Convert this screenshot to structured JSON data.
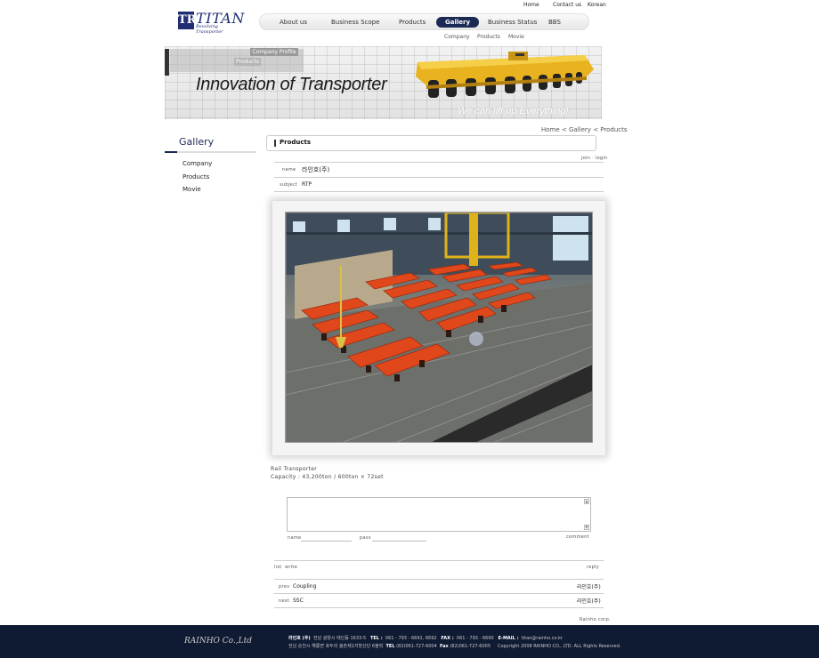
{
  "util_links": [
    "Home",
    "Contact us",
    "Korean"
  ],
  "logo": {
    "mark": "TR",
    "name": "TITAN",
    "tagline": "Revolving Transporter"
  },
  "nav": {
    "items": [
      "About us",
      "Business Scope",
      "Products",
      "Gallery",
      "Business Status",
      "BBS"
    ],
    "active": "Gallery",
    "sub": [
      "Company",
      "Products",
      "Movie"
    ]
  },
  "banner": {
    "tab1": "Company Profile",
    "tab2": "Products",
    "title": "Innovation of Transporter",
    "slogan": "We can lift up Everything!"
  },
  "breadcrumb": {
    "home": "Home",
    "section": "Gallery",
    "page": "Products",
    "sep": "<"
  },
  "sidebar": {
    "title": "Gallery",
    "items": [
      "Company",
      "Products",
      "Movie"
    ]
  },
  "content": {
    "heading": "Products",
    "join_login": "join · login",
    "name_label": "name",
    "name_value": "라인호(주)",
    "subject_label": "subject",
    "subject_value": "RTP",
    "caption_line1": "Rail Transporter",
    "caption_line2": "Capacity : 43,200ton / 600ton × 72set"
  },
  "comment": {
    "name_label": "name",
    "pass_label": "pass",
    "submit_label": "comment"
  },
  "board": {
    "list_label": "list",
    "write_label": "write",
    "reply_label": "reply",
    "prev_label": "prev",
    "prev_subject": "Coupling",
    "prev_author": "라인호(주)",
    "next_label": "next",
    "next_subject": "SSC",
    "next_author": "라인호(주)",
    "credit": "Rainho corp."
  },
  "footer": {
    "logo": "RAINHO Co.,Ltd",
    "line1_company": "라인호 (주)",
    "line1_addr": "전남 광양시 태인동 1633-5",
    "line1_tel_label": "TEL :",
    "line1_tel": "061 - 793 - 6691, 6692",
    "line1_fax_label": "FAX :",
    "line1_fax": "061 - 793 - 6690",
    "line1_email_label": "E-MAIL :",
    "line1_email": "titan@rainho.co.kr",
    "line2_addr": "전남 순천시 해룡면 호두리 율촌제1지방산단 6블럭",
    "line2_tel_label": "TEL",
    "line2_tel": "(82)061-727-6004",
    "line2_fax_label": "Fax",
    "line2_fax": "(82)061-727-6005",
    "copyright": "Copyright 2008 RAINHO CO., LTD. ALL Rights Reserved."
  },
  "colors": {
    "brand_navy": "#1b2a55",
    "footer_bg": "#0f1a33",
    "orange_trailer": "#e0481c",
    "yellow_truck": "#e9b320"
  }
}
